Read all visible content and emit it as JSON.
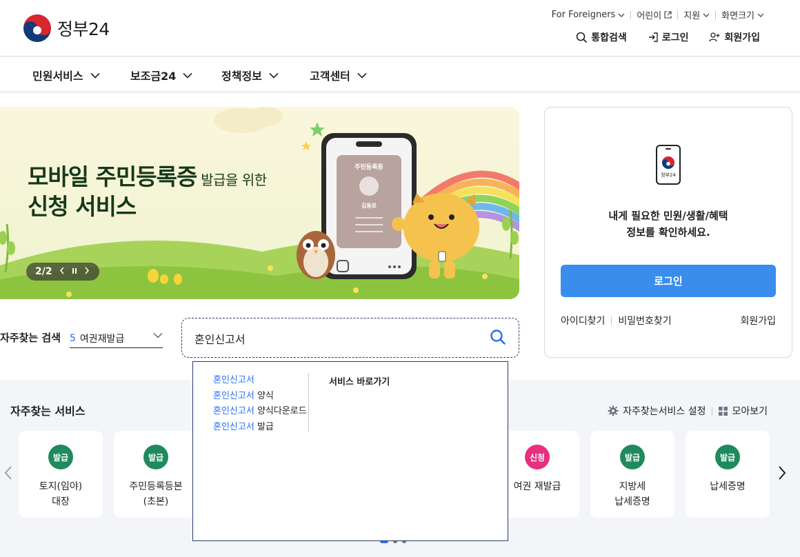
{
  "header": {
    "logo_text": "정부24",
    "util_links": [
      "For Foreigners",
      "어린이",
      "지원",
      "화면크기"
    ],
    "actions": [
      "통합검색",
      "로그인",
      "회원가입"
    ]
  },
  "gnb": {
    "items": [
      "민원서비스",
      "보조금24",
      "정책정보",
      "고객센터"
    ]
  },
  "banner": {
    "title_line1_bold": "모바일 주민등록증",
    "title_line1_small": " 발급을 위한",
    "title_line2": "신청 서비스",
    "pager": "2/2",
    "card_title": "주민등록증",
    "card_name": "김동로"
  },
  "login_card": {
    "app_label": "정부24",
    "message_line1": "내게 필요한 민원/생활/혜택",
    "message_line2": "정보를 확인하세요.",
    "login_button": "로그인",
    "find_id": "아이디찾기",
    "find_pw": "비밀번호찾기",
    "signup": "회원가입"
  },
  "search": {
    "label": "자주찾는 검색",
    "selected_rank": "5",
    "selected_value": "여권재발급",
    "query": "혼인신고서"
  },
  "autocomplete": {
    "suggestions": [
      {
        "match": "혼인신고서",
        "rest": ""
      },
      {
        "match": "혼인신고서",
        "rest": " 양식"
      },
      {
        "match": "혼인신고서",
        "rest": " 양식다운로드"
      },
      {
        "match": "혼인신고서",
        "rest": " 발급"
      }
    ],
    "shortcut_title": "서비스 바로가기"
  },
  "frequent_services": {
    "title": "자주찾는 서비스",
    "settings_label": "자주찾는서비스 설정",
    "view_all_label": "모아보기",
    "cards": [
      {
        "badge": "발급",
        "color": "green",
        "lines": [
          "토지(임야)",
          "대장"
        ]
      },
      {
        "badge": "발급",
        "color": "green",
        "lines": [
          "주민등록등본",
          "(초본)"
        ]
      },
      {
        "badge": "신청",
        "color": "pink",
        "lines": [
          "여권 재발급"
        ]
      },
      {
        "badge": "발급",
        "color": "green",
        "lines": [
          "지방세",
          "납세증명"
        ]
      },
      {
        "badge": "발급",
        "color": "green",
        "lines": [
          "납세증명"
        ]
      }
    ],
    "colors": {
      "green": "#1f8a5b",
      "pink": "#e8307f"
    }
  },
  "colors": {
    "primary": "#3a8ded",
    "link": "#256ef4",
    "text": "#1e2124",
    "section_bg": "#f3f5f8"
  }
}
